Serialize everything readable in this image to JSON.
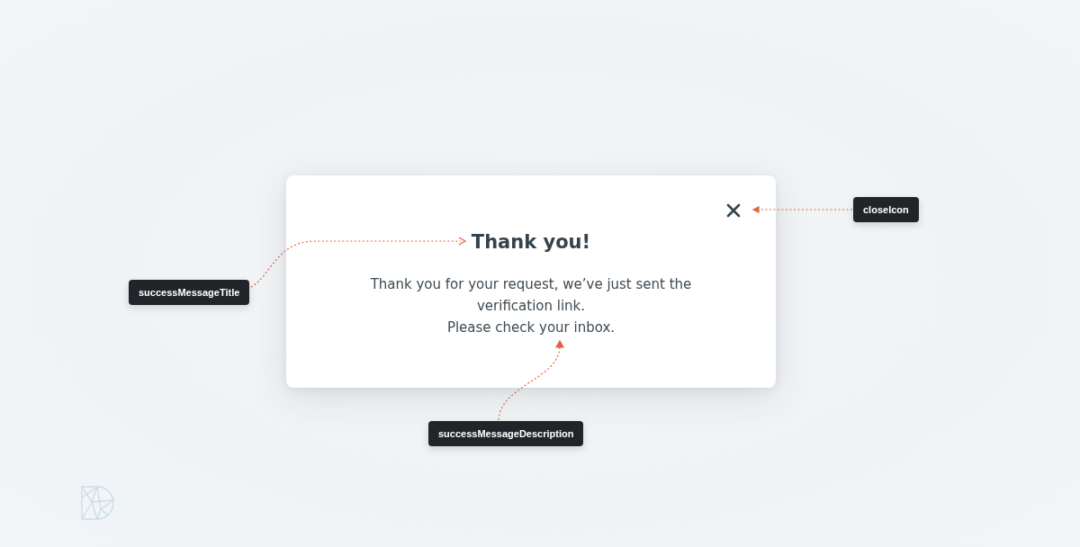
{
  "dialog": {
    "title": "Thank you!",
    "description": [
      "Thank you for your request, we’ve just sent the verification link.",
      "Please check your inbox."
    ]
  },
  "annotations": [
    {
      "label": "successMessageTitle",
      "kind": "title"
    },
    {
      "label": "successMessageDescription",
      "kind": "description"
    },
    {
      "label": "closeIcon",
      "kind": "close"
    }
  ]
}
